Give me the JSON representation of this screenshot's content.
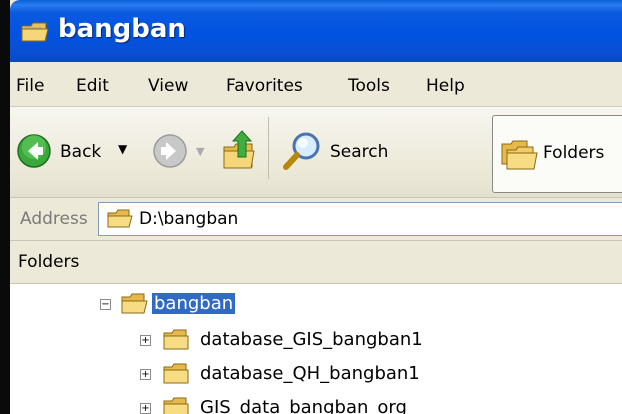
{
  "window": {
    "title": "bangban"
  },
  "menu": [
    "File",
    "Edit",
    "View",
    "Favorites",
    "Tools",
    "Help"
  ],
  "toolbar": {
    "back_label": "Back",
    "search_label": "Search",
    "folders_label": "Folders"
  },
  "address": {
    "label": "Address",
    "value": "D:\\bangban"
  },
  "pane": {
    "title": "Folders"
  },
  "tree": {
    "root": {
      "label": "bangban",
      "expander": "−"
    },
    "children": [
      {
        "label": "database_GIS_bangban1",
        "expander": "+"
      },
      {
        "label": "database_QH_bangban1",
        "expander": "+"
      },
      {
        "label": "GIS_data_bangban_org",
        "expander": "+"
      }
    ]
  },
  "colors": {
    "titlebar": "#0053e1",
    "selection": "#316ac5",
    "chrome": "#ece9d8"
  }
}
